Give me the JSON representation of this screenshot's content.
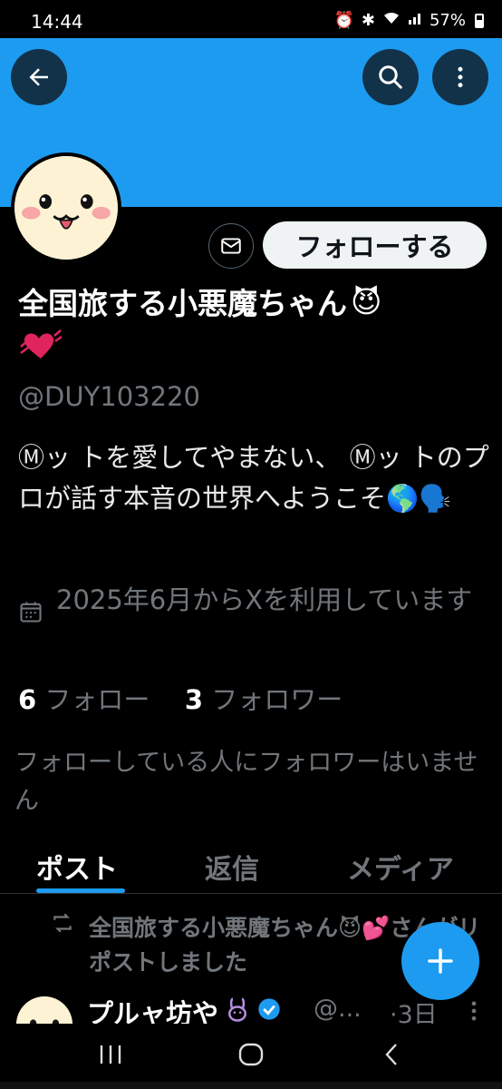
{
  "status_bar": {
    "time": "14:44",
    "battery": "57%"
  },
  "profile": {
    "banner_color": "#1d9bf0",
    "follow_label": "フォローする",
    "display_name": "全国旅する小悪魔ちゃん",
    "name_emoji": "😈",
    "handle": "@DUY103220",
    "bio": "Ⓜッ トを愛してやまない、 Ⓜッ トのプロが話す本音の世界へようこそ🌎🗣️",
    "joined": "2025年6月からXを利用しています",
    "following_count": "6",
    "following_label": "フォロー",
    "followers_count": "3",
    "followers_label": "フォロワー",
    "not_followed_note": "フォローしている人にフォロワーはいません"
  },
  "tabs": [
    {
      "label": "ポスト",
      "active": true
    },
    {
      "label": "返信",
      "active": false
    },
    {
      "label": "メディア",
      "active": false
    }
  ],
  "post": {
    "repost_text": "全国旅する小悪魔ちゃん😈💕さんがリポストしました",
    "author": "プルャ坊や",
    "handle": "@...",
    "time": "·3日"
  },
  "colors": {
    "accent": "#1d9bf0",
    "background": "#000000",
    "secondary_text": "#71767b"
  }
}
